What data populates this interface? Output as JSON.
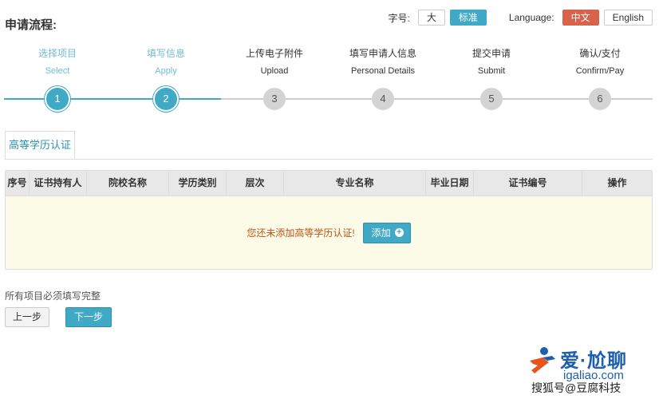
{
  "header": {
    "title": "申请流程:",
    "font_label": "字号:",
    "font_large": "大",
    "font_standard": "标准",
    "language_label": "Language:",
    "lang_cn": "中文",
    "lang_en": "English"
  },
  "steps": [
    {
      "num": "1",
      "cn": "选择项目",
      "en": "Select"
    },
    {
      "num": "2",
      "cn": "填写信息",
      "en": "Apply"
    },
    {
      "num": "3",
      "cn": "上传电子附件",
      "en": "Upload"
    },
    {
      "num": "4",
      "cn": "填写申请人信息",
      "en": "Personal Details"
    },
    {
      "num": "5",
      "cn": "提交申请",
      "en": "Submit"
    },
    {
      "num": "6",
      "cn": "确认/支付",
      "en": "Confirm/Pay"
    }
  ],
  "tab": {
    "label": "高等学历认证"
  },
  "table": {
    "columns": [
      "序号",
      "证书持有人",
      "院校名称",
      "学历类别",
      "层次",
      "专业名称",
      "毕业日期",
      "证书编号",
      "操作"
    ],
    "empty_message": "您还未添加高等学历认证!",
    "add_label": "添加"
  },
  "footer": {
    "notice": "所有项目必须填写完整",
    "prev_label": "上一步",
    "next_label": "下一步"
  },
  "watermark": {
    "brand": "爱·尬聊",
    "url": "igaliao.com",
    "caption": "搜狐号@豆腐科技"
  },
  "colors": {
    "accent": "#3fa9c6",
    "lang_active": "#d9624a",
    "empty_bg": "#fbfbe8",
    "empty_text": "#c0541a"
  }
}
